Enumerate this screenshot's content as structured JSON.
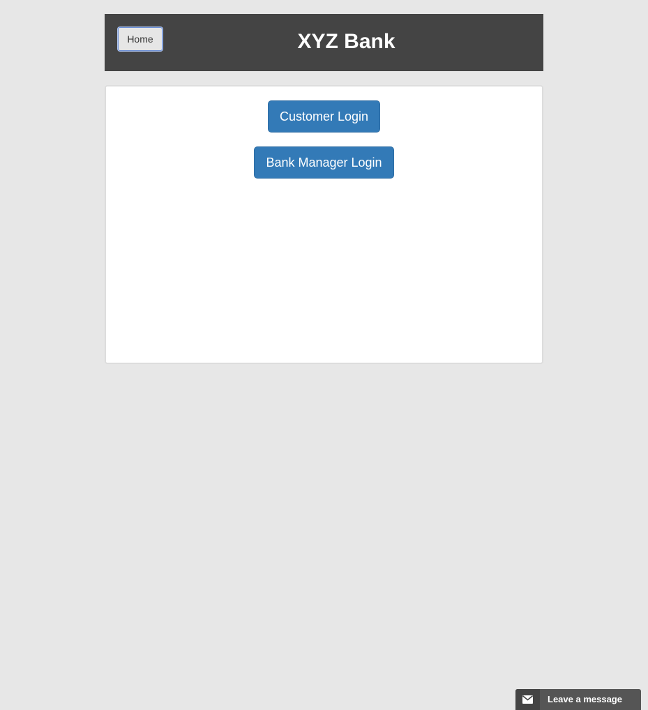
{
  "header": {
    "home_label": "Home",
    "title": "XYZ Bank"
  },
  "main": {
    "customer_login_label": "Customer Login",
    "manager_login_label": "Bank Manager Login"
  },
  "chat_widget": {
    "label": "Leave a message",
    "icon": "envelope-icon"
  },
  "colors": {
    "header_bg": "#444444",
    "page_bg": "#e7e7e7",
    "primary_button": "#337ab7",
    "widget_bg": "#555555"
  }
}
